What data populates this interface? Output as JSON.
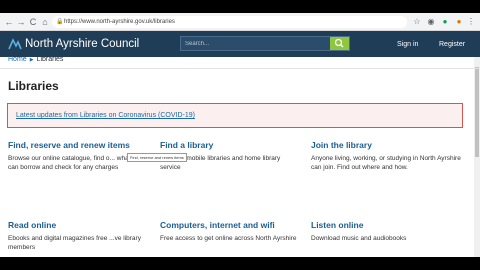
{
  "browser": {
    "url": "https://www.north-ayrshire.gov.uk/libraries",
    "back": "←",
    "forward": "→",
    "reload": "C",
    "home": "⌂"
  },
  "header": {
    "site_name": "North Ayrshire Council",
    "search_placeholder": "Search...",
    "sign_in": "Sign in",
    "register": "Register"
  },
  "breadcrumb": {
    "home": "Home",
    "separator": "▶",
    "current": "Libraries"
  },
  "page": {
    "title": "Libraries",
    "alert_link": "Latest updates from Libraries on Coronavirus (COVID-19)"
  },
  "tooltip": "Find, reserve and renew items",
  "cards": [
    {
      "title": "Find, reserve and renew items",
      "desc": "Browse our online catalogue, find o... what you can borrow and check for any charges"
    },
    {
      "title": "Find a library",
      "desc": "...ations, mobile libraries and home library service"
    },
    {
      "title": "Join the library",
      "desc": "Anyone living, working, or studying in North Ayrshire can join. Find out where and how."
    },
    {
      "title": "Read online",
      "desc": "Ebooks and digital magazines free ...ve library members"
    },
    {
      "title": "Computers, internet and wifi",
      "desc": "Free access to get online across North Ayrshire"
    },
    {
      "title": "Listen online",
      "desc": "Download music and audiobooks"
    }
  ]
}
